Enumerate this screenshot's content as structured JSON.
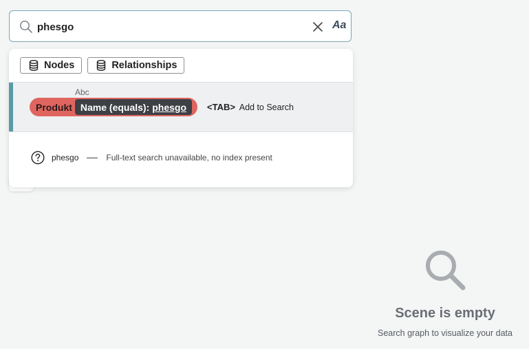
{
  "search": {
    "value": "phesgo",
    "case_toggle_label": "Aa"
  },
  "filters": {
    "nodes_label": "Nodes",
    "relationships_label": "Relationships"
  },
  "suggestion": {
    "type_hint": "Abc",
    "label": "Produkt",
    "property_text": "Name (equals):",
    "property_value": "phesgo",
    "tab_key": "<TAB>",
    "tab_action": "Add to Search",
    "label_color": "#e0655f",
    "accent_color": "#5a9aa8"
  },
  "fulltext": {
    "icon": "help-circle-icon",
    "term": "phesgo",
    "message": "Full-text search unavailable, no index present"
  },
  "empty_state": {
    "icon": "search-icon",
    "title": "Scene is empty",
    "subtitle": "Search graph to visualize your data"
  }
}
